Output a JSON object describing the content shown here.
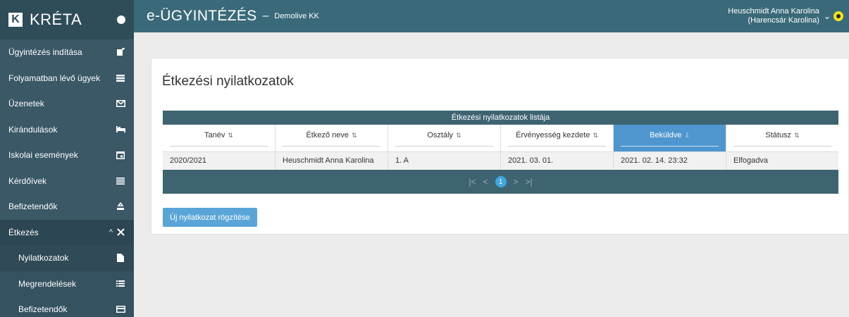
{
  "brand": {
    "logo_letter": "K",
    "name": "KRÉTA"
  },
  "sidebar": {
    "items": [
      {
        "label": "Ügyintézés indítása",
        "icon": "add-document-icon"
      },
      {
        "label": "Folyamatban lévő ügyek",
        "icon": "list-icon"
      },
      {
        "label": "Üzenetek",
        "icon": "envelope-icon"
      },
      {
        "label": "Kirándulások",
        "icon": "bus-icon"
      },
      {
        "label": "Iskolai események",
        "icon": "calendar-icon"
      },
      {
        "label": "Kérdőívek",
        "icon": "survey-icon"
      },
      {
        "label": "Befizetendők",
        "icon": "money-icon"
      },
      {
        "label": "Étkezés",
        "icon": "cutlery-icon",
        "expand": "^"
      }
    ],
    "submenu": [
      {
        "label": "Nyilatkozatok",
        "icon": "file-icon"
      },
      {
        "label": "Megrendelések",
        "icon": "list-icon"
      },
      {
        "label": "Befizetendők",
        "icon": "card-icon"
      }
    ]
  },
  "header": {
    "title": "e-ÜGYINTÉZÉS",
    "separator": "–",
    "school": "Demolive KK",
    "user_name": "Heuschmidt Anna Karolina",
    "user_child": "(Harencsár Karolina)"
  },
  "page": {
    "title": "Étkezési nyilatkozatok"
  },
  "grid": {
    "caption": "Étkezési nyilatkozatok listája",
    "columns": [
      "Tanév",
      "Étkező neve",
      "Osztály",
      "Érvényesség kezdete",
      "Beküldve",
      "Státusz"
    ],
    "rows": [
      [
        "2020/2021",
        "Heuschmidt Anna Karolina",
        "1. A",
        "2021. 03. 01.",
        "2021. 02. 14. 23:32",
        "Elfogadva"
      ]
    ],
    "pager": {
      "first": "|<",
      "prev": "<",
      "current": "1",
      "next": ">",
      "last": ">|"
    }
  },
  "actions": {
    "new_label": "Új nyilatkozat rögzítése"
  },
  "colors": {
    "sidebar": "#3a5866",
    "topbar": "#3a6a7a",
    "grid_header": "#3e6472",
    "active_column": "#4f96cf",
    "button": "#5aa5d8"
  }
}
